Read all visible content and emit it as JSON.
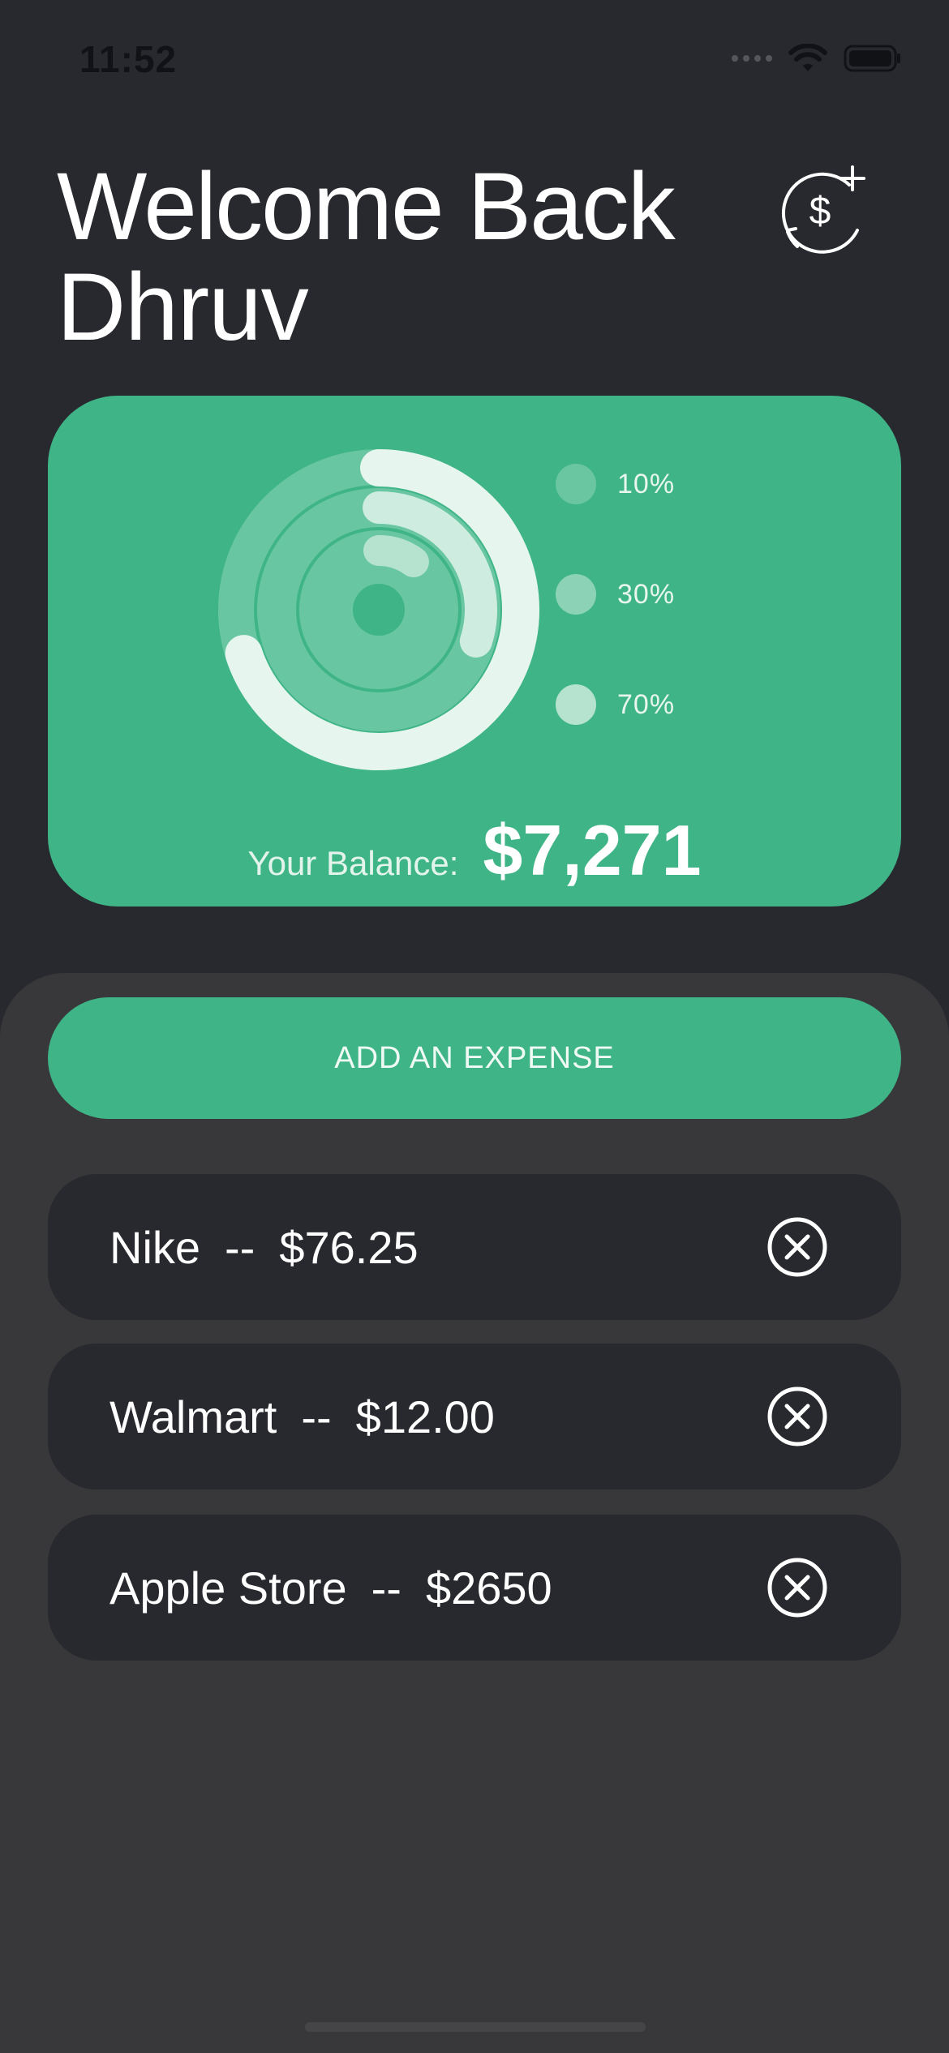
{
  "status_bar": {
    "time": "11:52"
  },
  "header": {
    "greeting": "Welcome Back",
    "user_name": "Dhruv",
    "action_icon": "currency-exchange-add-icon"
  },
  "balance_card": {
    "label": "Your Balance:",
    "amount": "$7,271",
    "chart": {
      "type": "rings",
      "rings": [
        {
          "label": "10%",
          "value": 0.1
        },
        {
          "label": "30%",
          "value": 0.3
        },
        {
          "label": "70%",
          "value": 0.7
        }
      ]
    },
    "legend": [
      {
        "label": "10%",
        "color": "#8ed3b6"
      },
      {
        "label": "30%",
        "color": "#a6dcc5"
      },
      {
        "label": "70%",
        "color": "#c2e8d8"
      }
    ]
  },
  "expenses": {
    "add_button_label": "ADD AN EXPENSE",
    "items": [
      {
        "name": "Nike",
        "separator": "--",
        "amount": "$76.25"
      },
      {
        "name": "Walmart",
        "separator": "--",
        "amount": "$12.00"
      },
      {
        "name": "Apple Store",
        "separator": "--",
        "amount": "$2650"
      }
    ]
  },
  "colors": {
    "background": "#28292e",
    "accent": "#3fb587",
    "sheet": "#38383a"
  }
}
